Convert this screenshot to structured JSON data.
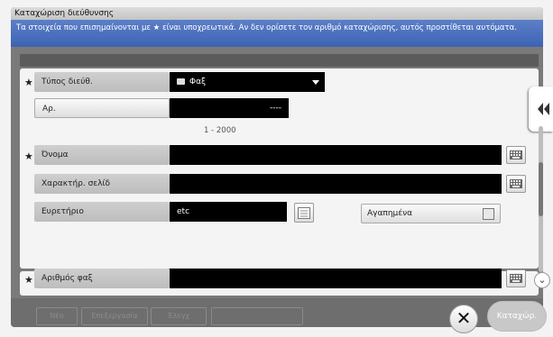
{
  "window": {
    "title": "Καταχώριση διεύθυνσης",
    "info": "Τα στοιχεία που επισημαίνονται με ★ είναι υποχρεωτικά. Αν δεν ορίσετε τον αριθμό καταχώρισης, αυτός προστίθεται αυτόματα."
  },
  "form": {
    "required_mark": "★",
    "address_type": {
      "label": "Τύπος διεύθ.",
      "value": "Φαξ",
      "icon": "fax-icon"
    },
    "number": {
      "label": "Αρ.",
      "value": "----",
      "range": "1 - 2000"
    },
    "name": {
      "label": "Όνομα",
      "value": ""
    },
    "sort_char": {
      "label": "Χαρακτήρ. σελίδ",
      "value": ""
    },
    "index": {
      "label": "Ευρετήριο",
      "value": "etc",
      "icon": "index-list-icon"
    },
    "favorites": {
      "label": "Αγαπημένα",
      "checked": false
    },
    "fax_number": {
      "label": "Αριθμός φαξ",
      "value": ""
    }
  },
  "bottom": {
    "tabs": [
      "Νέο",
      "Επεξεργασία",
      "Έλεγχ",
      ""
    ],
    "close_icon": "close-icon",
    "ok_label": "Καταχώρ."
  },
  "side": {
    "collapse_icon": "double-chevron-left-icon",
    "scroll_down_icon": "chevron-down-icon"
  }
}
